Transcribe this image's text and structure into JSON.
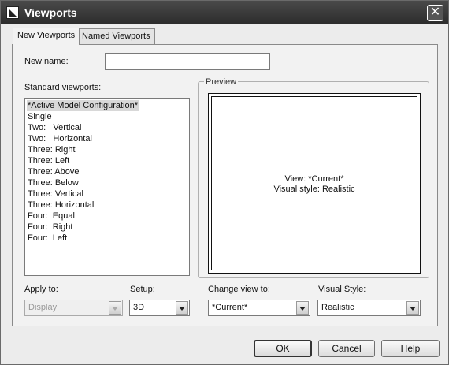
{
  "window": {
    "title": "Viewports",
    "close_symbol": "✕",
    "icon": "app-icon"
  },
  "tabs": [
    {
      "label": "New Viewports",
      "active": true
    },
    {
      "label": "Named Viewports",
      "active": false
    }
  ],
  "form": {
    "new_name_label": "New name:",
    "new_name_value": "",
    "standard_viewports_label": "Standard viewports:",
    "standard_viewports": [
      "*Active Model Configuration*",
      "Single",
      "Two:   Vertical",
      "Two:   Horizontal",
      "Three: Right",
      "Three: Left",
      "Three: Above",
      "Three: Below",
      "Three: Vertical",
      "Three: Horizontal",
      "Four:  Equal",
      "Four:  Right",
      "Four:  Left"
    ],
    "selected_index": 0,
    "apply_to_label": "Apply to:",
    "apply_to_value": "Display",
    "setup_label": "Setup:",
    "setup_value": "3D"
  },
  "preview": {
    "group_title": "Preview",
    "line1": "View: *Current*",
    "line2": "Visual style: Realistic",
    "change_view_label": "Change view to:",
    "change_view_value": "*Current*",
    "visual_style_label": "Visual Style:",
    "visual_style_value": "Realistic"
  },
  "buttons": {
    "ok": "OK",
    "cancel": "Cancel",
    "help": "Help"
  }
}
